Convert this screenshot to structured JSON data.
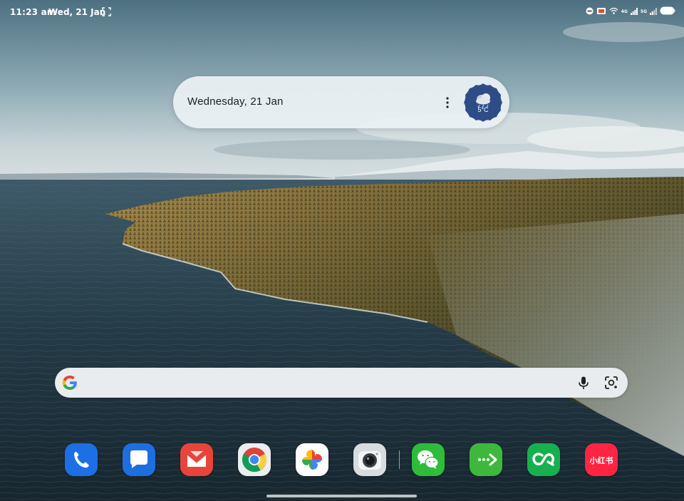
{
  "status_bar": {
    "time": "11:23 am",
    "date": "Wed, 21 Jan",
    "network_label": "4G",
    "network_label_2": "5G",
    "icons": [
      "do-not-disturb-icon",
      "cast-icon",
      "wifi-icon",
      "signal-icon",
      "signal-icon-2",
      "battery-icon"
    ]
  },
  "widget": {
    "date_text": "Wednesday, 21 Jan",
    "temperature": "5°C",
    "weather_icon": "cloud-rain-icon"
  },
  "search": {
    "value": "",
    "placeholder": ""
  },
  "dock": {
    "apps": [
      {
        "name": "phone",
        "icon": "phone-icon"
      },
      {
        "name": "messages",
        "icon": "messages-icon"
      },
      {
        "name": "mail",
        "icon": "mail-icon"
      },
      {
        "name": "chrome",
        "icon": "chrome-icon"
      },
      {
        "name": "photos",
        "icon": "photos-icon"
      },
      {
        "name": "camera",
        "icon": "camera-icon"
      },
      {
        "name": "wechat",
        "icon": "wechat-icon"
      },
      {
        "name": "file-transfer",
        "icon": "transfer-icon"
      },
      {
        "name": "infinity-app",
        "icon": "infinity-icon"
      },
      {
        "name": "xiaohongshu",
        "icon": "xiaohongshu-icon",
        "label": "小红书"
      }
    ]
  },
  "colors": {
    "phone": "#1c6fe4",
    "messages": "#1d6fe0",
    "mail": "#e8443a",
    "wechat": "#2dbd3a",
    "transfer": "#3eb83c",
    "infinity": "#17b04f",
    "xiaohongshu": "#ff2442",
    "weather_badge": "#2e4d86"
  }
}
